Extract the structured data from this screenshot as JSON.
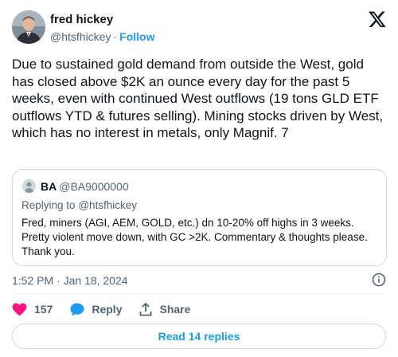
{
  "author": {
    "name": "fred hickey",
    "handle": "@htsfhickey",
    "separator": "·",
    "follow_label": "Follow"
  },
  "tweet": {
    "text": "Due to sustained gold demand from outside the West, gold has closed above $2K an ounce every day for the past 5 weeks, even with continued West outflows (19 tons GLD ETF outflows YTD & futures selling). Mining stocks driven by West, which has no interest in metals, only Magnif. 7"
  },
  "quote": {
    "name": "BA",
    "handle": "@BA9000000",
    "replying_prefix": "Replying to",
    "replying_handle": "@htsfhickey",
    "text": "Fred, miners (AGI, AEM, GOLD, etc.) dn 10-20% off highs in 3 weeks. Pretty violent move down, with GC >2K.  Commentary & thoughts please. Thank you."
  },
  "meta": {
    "timestamp": "1:52 PM · Jan 18, 2024"
  },
  "actions": {
    "like_count": "157",
    "reply_label": "Reply",
    "share_label": "Share"
  },
  "read_replies_label": "Read 14 replies",
  "colors": {
    "accent": "#1d9bf0",
    "like": "#f91880",
    "muted": "#536471",
    "border": "#cfd9de"
  },
  "icons": [
    "x-logo-icon",
    "info-icon",
    "heart-icon",
    "reply-bubble-icon",
    "share-icon"
  ]
}
